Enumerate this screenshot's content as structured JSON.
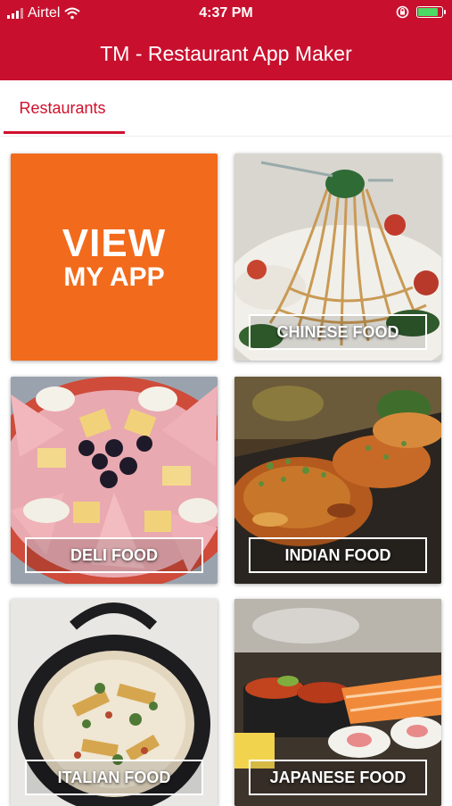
{
  "status_bar": {
    "carrier": "Airtel",
    "time": "4:37 PM",
    "battery_level": 0.85
  },
  "app_bar": {
    "title": "TM - Restaurant App Maker"
  },
  "tabs": [
    {
      "label": "Restaurants",
      "selected": true
    }
  ],
  "view_tile": {
    "line1": "VIEW",
    "line2": "MY APP",
    "color": "#f26a1b"
  },
  "categories": [
    {
      "label": "CHINESE FOOD"
    },
    {
      "label": "DELI FOOD"
    },
    {
      "label": "INDIAN FOOD"
    },
    {
      "label": "ITALIAN FOOD"
    },
    {
      "label": "JAPANESE FOOD"
    }
  ],
  "colors": {
    "primary": "#c8102e",
    "accent": "#f26a1b",
    "tab_active": "#d0102c"
  }
}
